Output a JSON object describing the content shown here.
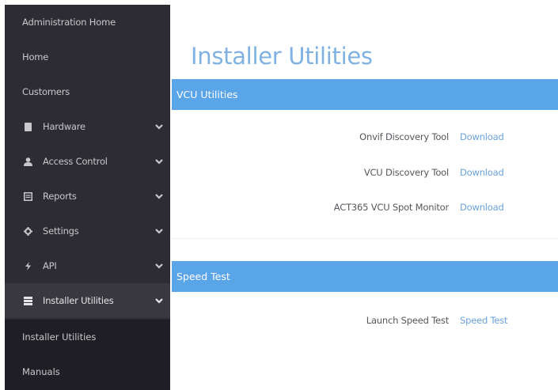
{
  "sidebar": {
    "items": [
      {
        "label": "Administration Home"
      },
      {
        "label": "Home"
      },
      {
        "label": "Customers"
      },
      {
        "label": "Hardware",
        "icon": "hardware-icon"
      },
      {
        "label": "Access Control",
        "icon": "user-icon"
      },
      {
        "label": "Reports",
        "icon": "reports-icon"
      },
      {
        "label": "Settings",
        "icon": "gear-icon"
      },
      {
        "label": "API",
        "icon": "bolt-icon"
      },
      {
        "label": "Installer Utilities",
        "icon": "server-icon",
        "active": true
      }
    ],
    "submenu": [
      {
        "label": "Installer Utilities"
      },
      {
        "label": "Manuals"
      }
    ]
  },
  "main": {
    "title": "Installer Utilities",
    "sections": [
      {
        "title": "VCU Utilities",
        "tools": [
          {
            "label": "Onvif Discovery Tool",
            "link": "Download"
          },
          {
            "label": "VCU Discovery Tool",
            "link": "Download"
          },
          {
            "label": "ACT365 VCU Spot Monitor",
            "link": "Download"
          }
        ]
      },
      {
        "title": "Speed Test",
        "tools": [
          {
            "label": "Launch Speed Test",
            "link": "Speed Test"
          }
        ]
      }
    ]
  },
  "colors": {
    "sidebar_bg": "#2d2c33",
    "submenu_bg": "#1f1e24",
    "accent": "#5aa4e8",
    "title": "#7fb2e2",
    "link": "#6aa3dc"
  }
}
